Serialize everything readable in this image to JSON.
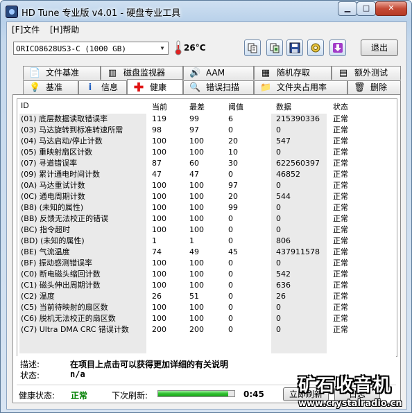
{
  "window": {
    "title": "HD Tune 专业版 v4.01 - 硬盘专业工具",
    "min_label": "▁",
    "max_label": "□",
    "close_label": "✕"
  },
  "menu": {
    "file": "[F]文件",
    "help": "[H]帮助"
  },
  "toolbar": {
    "drive": "ORICO8628US3-C (1000 GB)",
    "temperature": "26°C",
    "exit_label": "退出",
    "icons": [
      "copy-info-icon",
      "copy-screen-icon",
      "save-icon",
      "options-icon",
      "download-icon"
    ]
  },
  "tabs_top": [
    {
      "label": "文件基准",
      "icon": "file-benchmark-icon"
    },
    {
      "label": "磁盘监视器",
      "icon": "disk-monitor-icon"
    },
    {
      "label": "AAM",
      "icon": "speaker-icon"
    },
    {
      "label": "随机存取",
      "icon": "random-access-icon"
    },
    {
      "label": "额外测试",
      "icon": "extra-tests-icon"
    }
  ],
  "tabs_bottom": [
    {
      "label": "基准",
      "icon": "benchmark-icon"
    },
    {
      "label": "信息",
      "icon": "info-icon"
    },
    {
      "label": "健康",
      "icon": "health-cross-icon"
    },
    {
      "label": "错误扫描",
      "icon": "magnifier-icon"
    },
    {
      "label": "文件夹占用率",
      "icon": "folder-icon"
    },
    {
      "label": "删除",
      "icon": "trash-icon"
    }
  ],
  "table": {
    "headers": [
      "ID",
      "当前",
      "最差",
      "阈值",
      "数据",
      "状态"
    ],
    "rows": [
      {
        "id": "(01) 底层数据读取错误率",
        "cur": "119",
        "worst": "99",
        "thr": "6",
        "data": "215390336",
        "status": "正常"
      },
      {
        "id": "(03) 马达旋转到标准转速所需",
        "cur": "98",
        "worst": "97",
        "thr": "0",
        "data": "0",
        "status": "正常"
      },
      {
        "id": "(04) 马达启动/停止计数",
        "cur": "100",
        "worst": "100",
        "thr": "20",
        "data": "547",
        "status": "正常"
      },
      {
        "id": "(05) 重映射扇区计数",
        "cur": "100",
        "worst": "100",
        "thr": "10",
        "data": "0",
        "status": "正常"
      },
      {
        "id": "(07) 寻道错误率",
        "cur": "87",
        "worst": "60",
        "thr": "30",
        "data": "622560397",
        "status": "正常"
      },
      {
        "id": "(09) 累计通电时间计数",
        "cur": "47",
        "worst": "47",
        "thr": "0",
        "data": "46852",
        "status": "正常"
      },
      {
        "id": "(0A) 马达重试计数",
        "cur": "100",
        "worst": "100",
        "thr": "97",
        "data": "0",
        "status": "正常"
      },
      {
        "id": "(0C) 通电周期计数",
        "cur": "100",
        "worst": "100",
        "thr": "20",
        "data": "544",
        "status": "正常"
      },
      {
        "id": "(B8) (未知的属性)",
        "cur": "100",
        "worst": "100",
        "thr": "99",
        "data": "0",
        "status": "正常"
      },
      {
        "id": "(BB) 反馈无法校正的错误",
        "cur": "100",
        "worst": "100",
        "thr": "0",
        "data": "0",
        "status": "正常"
      },
      {
        "id": "(BC) 指令超时",
        "cur": "100",
        "worst": "100",
        "thr": "0",
        "data": "0",
        "status": "正常"
      },
      {
        "id": "(BD) (未知的属性)",
        "cur": "1",
        "worst": "1",
        "thr": "0",
        "data": "806",
        "status": "正常"
      },
      {
        "id": "(BE) 气流温度",
        "cur": "74",
        "worst": "49",
        "thr": "45",
        "data": "437911578",
        "status": "正常"
      },
      {
        "id": "(BF) 振动感测错误率",
        "cur": "100",
        "worst": "100",
        "thr": "0",
        "data": "0",
        "status": "正常"
      },
      {
        "id": "(C0) 断电磁头缩回计数",
        "cur": "100",
        "worst": "100",
        "thr": "0",
        "data": "542",
        "status": "正常"
      },
      {
        "id": "(C1) 磁头伸出周期计数",
        "cur": "100",
        "worst": "100",
        "thr": "0",
        "data": "636",
        "status": "正常"
      },
      {
        "id": "(C2) 温度",
        "cur": "26",
        "worst": "51",
        "thr": "0",
        "data": "26",
        "status": "正常"
      },
      {
        "id": "(C5) 当前待映射的扇区数",
        "cur": "100",
        "worst": "100",
        "thr": "0",
        "data": "0",
        "status": "正常"
      },
      {
        "id": "(C6) 脱机无法校正的扇区数",
        "cur": "100",
        "worst": "100",
        "thr": "0",
        "data": "0",
        "status": "正常"
      },
      {
        "id": "(C7) Ultra DMA CRC 错误计数",
        "cur": "200",
        "worst": "200",
        "thr": "0",
        "data": "0",
        "status": "正常"
      }
    ]
  },
  "info": {
    "desc_label": "描述:",
    "desc_value": "在项目上点击可以获得更加详细的有关说明",
    "state_label": "状态:",
    "state_value": "n/a"
  },
  "status": {
    "health_label": "健康状态:",
    "health_value": "正常",
    "health_color": "#008000",
    "refresh_label": "下次刷新:",
    "refresh_progress": 0.92,
    "countdown": "0:45",
    "refresh_button": "立即刷新",
    "log_button": "日志"
  },
  "watermark": {
    "logo": "矿石收音机",
    "url": "www.crystalradio.cn"
  }
}
